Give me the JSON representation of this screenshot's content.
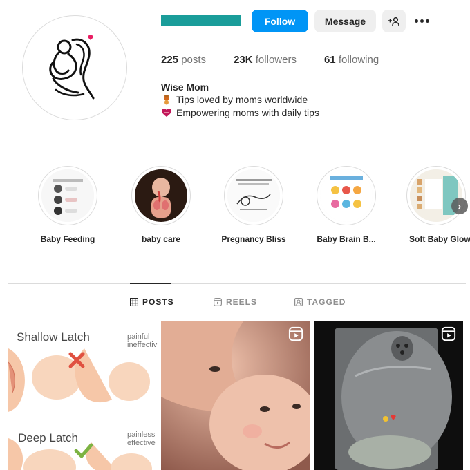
{
  "profile": {
    "name": "Wise Mom",
    "bio_line1": "Tips loved by moms worldwide",
    "bio_line2": "Empowering moms with daily tips",
    "bio_line1_icon": "pacifier-icon",
    "bio_line2_icon": "heart-icon"
  },
  "actions": {
    "follow": "Follow",
    "message": "Message",
    "add_user_icon": "+8",
    "more_icon": "more-icon"
  },
  "stats": [
    {
      "value": "225",
      "label": "posts"
    },
    {
      "value": "23K",
      "label": "followers"
    },
    {
      "value": "61",
      "label": "following"
    }
  ],
  "highlights": [
    {
      "label": "Baby Feeding"
    },
    {
      "label": "baby care"
    },
    {
      "label": "Pregnancy Bliss"
    },
    {
      "label": "Baby Brain B..."
    },
    {
      "label": "Soft Baby Glow"
    }
  ],
  "tabs": [
    {
      "label": "POSTS",
      "icon": "grid-icon",
      "active": true
    },
    {
      "label": "REELS",
      "icon": "reels-icon",
      "active": false
    },
    {
      "label": "TAGGED",
      "icon": "tagged-icon",
      "active": false
    }
  ],
  "posts": {
    "post1": {
      "shallow": "Shallow Latch",
      "deep": "Deep Latch",
      "note1a": "painful",
      "note1b": "ineffectiv",
      "note2a": "painless",
      "note2b": "effective"
    }
  },
  "colors": {
    "accent": "#0095f6",
    "username_redaction": "#1a9d9a",
    "heart": "#e91e63"
  }
}
